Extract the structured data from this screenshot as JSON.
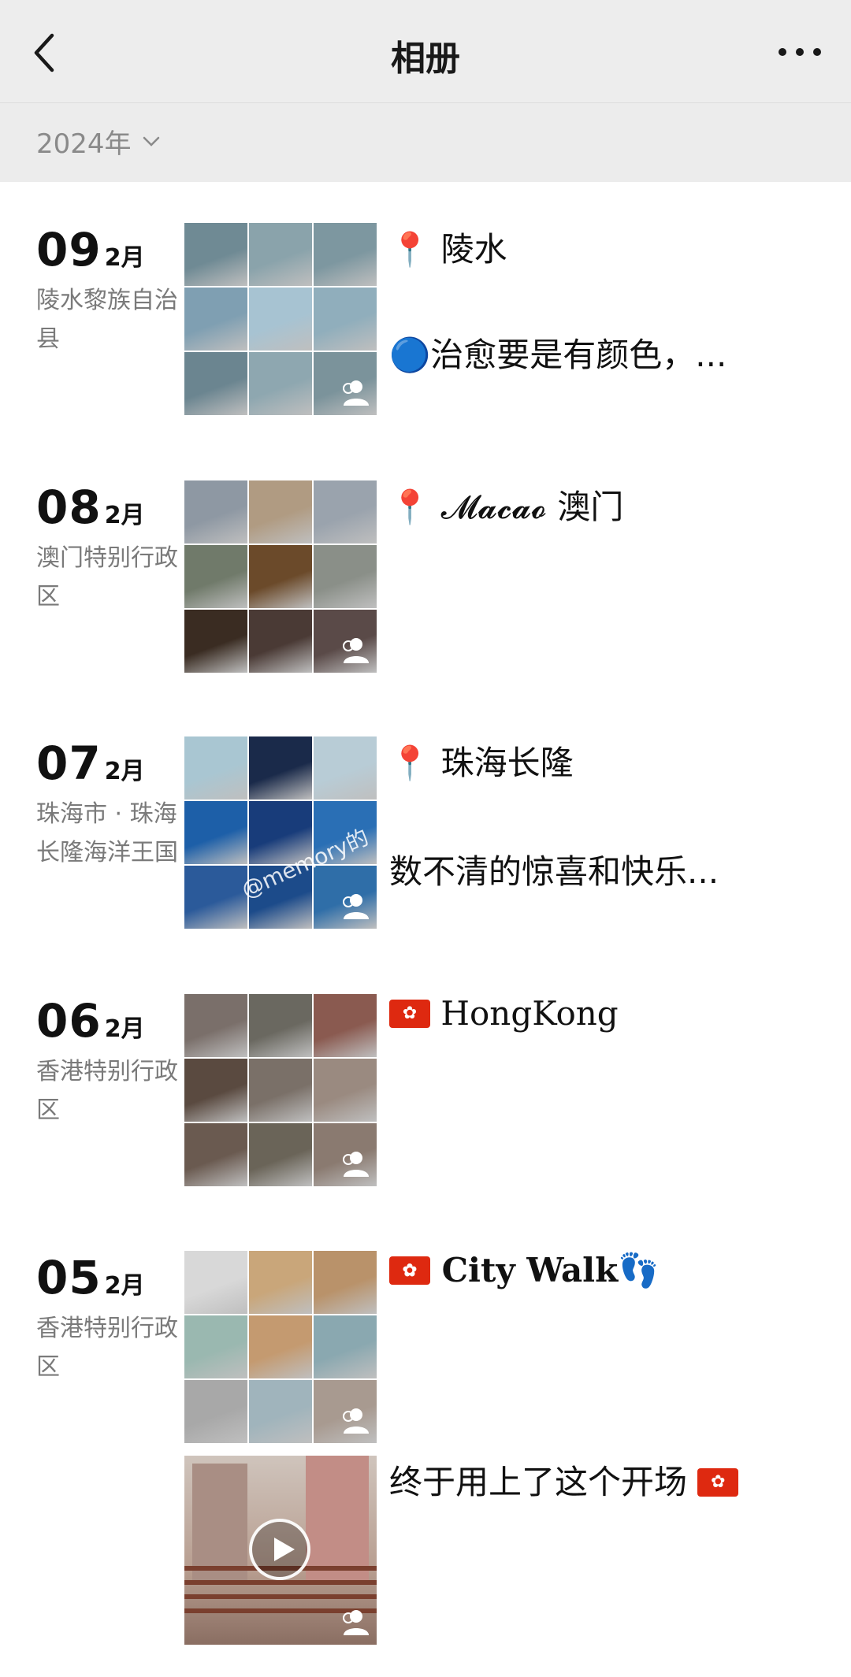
{
  "header": {
    "title": "相册"
  },
  "year_filter": {
    "label": "2024年"
  },
  "entries": [
    {
      "day": "09",
      "month": "2月",
      "place": "陵水黎族自治县",
      "lines": [
        "📍 陵水",
        "🔵治愈要是有颜色，..."
      ],
      "colors": [
        "#6f8a94",
        "#8aa3ab",
        "#7d97a0",
        "#7f9fb2",
        "#a7c3d2",
        "#90aebc",
        "#6b8590",
        "#8ea7b0",
        "#7b939b"
      ]
    },
    {
      "day": "08",
      "month": "2月",
      "place": "澳门特别行政区",
      "lines": [
        "📍 𝓜𝓪𝓬𝓪𝓸 澳门"
      ],
      "colors": [
        "#8e98a3",
        "#b09b82",
        "#9aa3ad",
        "#707a6a",
        "#6b4a2a",
        "#8a8f88",
        "#3a2c22",
        "#4a3a35",
        "#5a4a48"
      ]
    },
    {
      "day": "07",
      "month": "2月",
      "place": "珠海市 · 珠海长隆海洋王国",
      "lines": [
        "📍 珠海长隆",
        "数不清的惊喜和快乐..."
      ],
      "overlay": "@memory的",
      "colors": [
        "#a9c6d2",
        "#1a2a4a",
        "#b8ccd6",
        "#1d5fa8",
        "#183c7a",
        "#2a6fb5",
        "#2b5a9a",
        "#1c4b8a",
        "#2f6ea8"
      ]
    },
    {
      "day": "06",
      "month": "2月",
      "place": "香港特别行政区",
      "lines": [
        "HongKong"
      ],
      "colors": [
        "#7a6f6a",
        "#6a6860",
        "#8a5a50",
        "#5a4a40",
        "#7a7068",
        "#9a8a80",
        "#6a5a50",
        "#6a6458",
        "#8a7a70"
      ]
    },
    {
      "day": "05",
      "month": "2月",
      "place": "香港特别行政区",
      "lines": [
        "City Walk👣",
        "终于用上了这个开场"
      ],
      "colors": [
        "#d8d8d8",
        "#c9a67a",
        "#b9926a",
        "#9ab8b0",
        "#c49a70",
        "#8aa8b0",
        "#a8a8a8",
        "#a0b4bc",
        "#a89a90"
      ],
      "video_colors": [
        "#c9bcb2",
        "#b79a8c"
      ]
    }
  ]
}
